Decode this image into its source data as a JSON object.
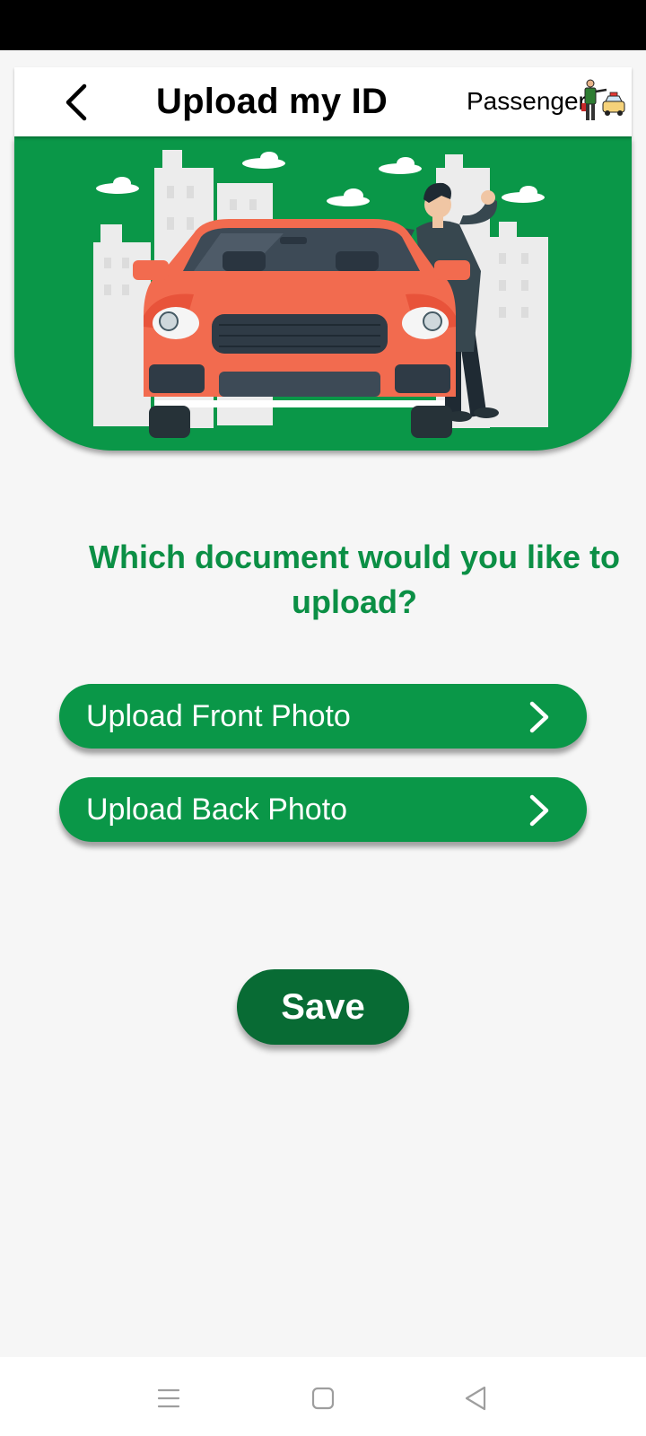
{
  "header": {
    "title": "Upload my ID",
    "role_label": "Passenger",
    "back_icon": "chevron-left-icon",
    "role_icon": "passenger-taxi-icon"
  },
  "banner": {
    "illustration": "red-car-with-man-illustration",
    "background_color": "#0a9748"
  },
  "main": {
    "question": "Which document would you like to upload?",
    "buttons": [
      {
        "label": "Upload Front Photo",
        "icon": "chevron-right-icon"
      },
      {
        "label": "Upload Back Photo",
        "icon": "chevron-right-icon"
      }
    ],
    "save_label": "Save"
  },
  "nav_bar": {
    "items": [
      "menu-icon",
      "home-square-icon",
      "back-triangle-icon"
    ]
  },
  "colors": {
    "accent": "#0a9748",
    "question_text": "#0b8f45",
    "save_button": "#086b34"
  }
}
